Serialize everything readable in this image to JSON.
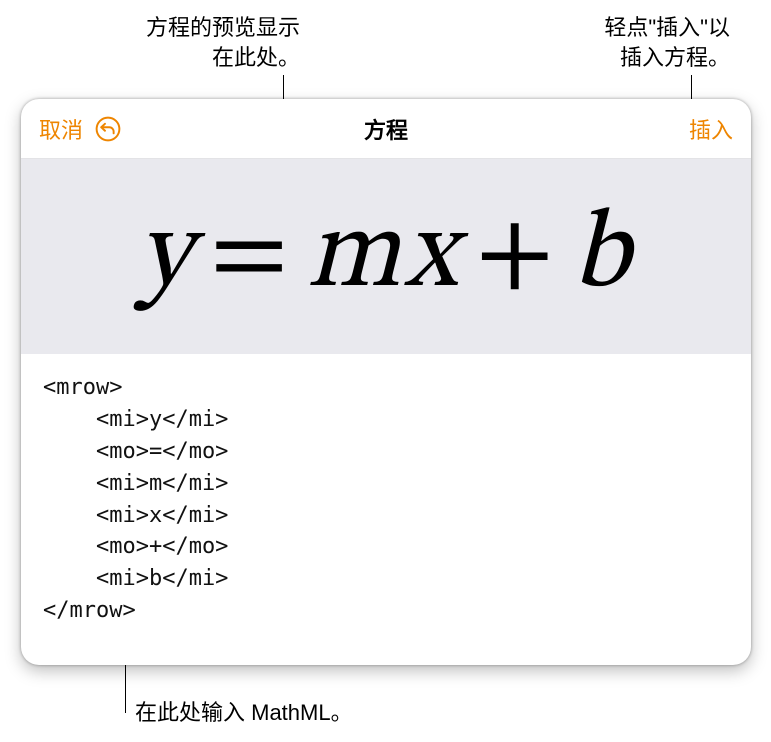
{
  "callouts": {
    "preview_text": "方程的预览显示\n在此处。",
    "insert_text": "轻点\"插入\"以\n插入方程。",
    "mathml_text": "在此处输入 MathML。"
  },
  "toolbar": {
    "cancel_label": "取消",
    "title": "方程",
    "insert_label": "插入"
  },
  "equation": {
    "y": "y",
    "eq": "=",
    "m": "m",
    "x": "x",
    "plus": "+",
    "b": "b"
  },
  "editor": {
    "code": "<mrow>\n    <mi>y</mi>\n    <mo>=</mo>\n    <mi>m</mi>\n    <mi>x</mi>\n    <mo>+</mo>\n    <mi>b</mi>\n</mrow>"
  }
}
